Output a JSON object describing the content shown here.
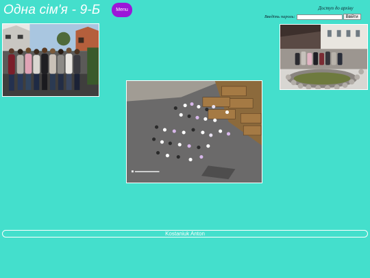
{
  "header": {
    "title": "Одна сім'я - 9-Б",
    "menu_label": "Menu"
  },
  "archive": {
    "heading": "Доступ до архіву",
    "password_label": "Введіть пароль:",
    "password_value": "",
    "enter_label": "Ввійти"
  },
  "photos": {
    "left_alt": "Group of students standing outdoors near a building",
    "right_alt": "Group of students by a pond in a courtyard",
    "center_alt": "Aerial photo of students in a courtyard"
  },
  "footer": {
    "author": "Kostaniuk Anton"
  },
  "colors": {
    "background": "#44dfcc",
    "menu_button": "#9b17d8",
    "title_text": "#ffffff"
  }
}
